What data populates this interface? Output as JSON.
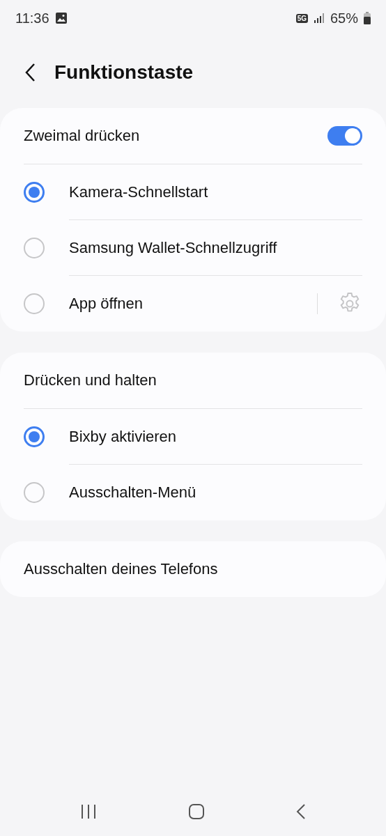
{
  "status_bar": {
    "time": "11:36",
    "network": "5G",
    "battery": "65%"
  },
  "header": {
    "title": "Funktionstaste"
  },
  "sections": [
    {
      "title": "Zweimal drücken",
      "kind": "toggle",
      "on": true,
      "options": [
        {
          "label": "Kamera-Schnellstart",
          "selected": true
        },
        {
          "label": "Samsung Wallet-Schnellzugriff",
          "selected": false
        },
        {
          "label": "App öffnen",
          "selected": false,
          "settings": true,
          "settings_disabled": true
        }
      ]
    },
    {
      "title": "Drücken und halten",
      "kind": "plain",
      "options": [
        {
          "label": "Bixby aktivieren",
          "selected": true
        },
        {
          "label": "Ausschalten-Menü",
          "selected": false
        }
      ]
    },
    {
      "title": "Ausschalten deines Telefons",
      "kind": "link"
    }
  ]
}
